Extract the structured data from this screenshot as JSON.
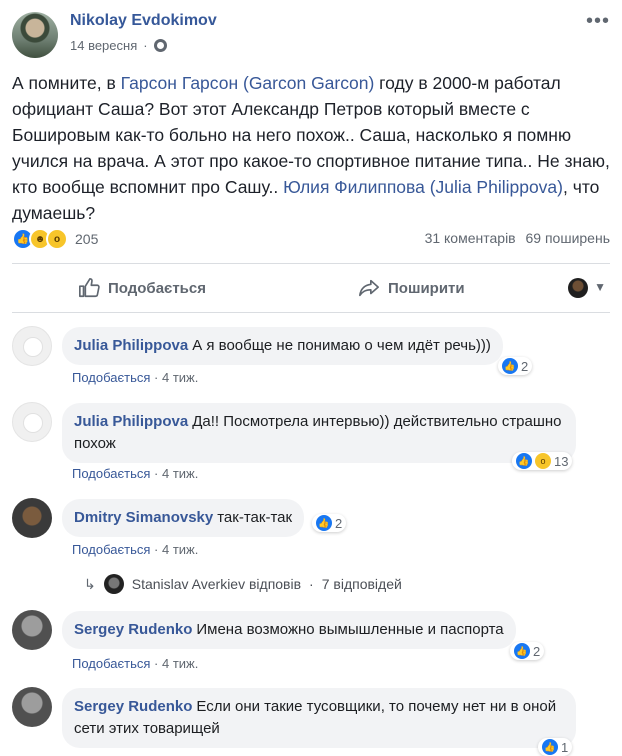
{
  "post": {
    "author": "Nikolay Evdokimov",
    "date": "14 вересня",
    "text_parts": [
      "А помните, в ",
      "Гарсон Гарсон (Garcon Garcon)",
      " году в 2000-м работал официант Саша? Вот этот Александр Петров который вместе с Бошировым как-то больно на него похож.. Саша, насколько я помню учился на врача. А этот про какое-то спортивное питание типа.. Не знаю, кто вообще вспомнит про Сашу.. ",
      "Юлия Филиппова (Julia Philippova)",
      ", что думаешь?"
    ],
    "reactions_count": "205",
    "comments_count": "31 коментарів",
    "shares_count": "69 поширень"
  },
  "actions": {
    "like": "Подобається",
    "share": "Поширити"
  },
  "comments": [
    {
      "name": "Julia Philippova",
      "text": "А я вообще не понимаю о чем идёт речь)))",
      "like": "Подобається",
      "time": "4 тиж.",
      "reactions": "2"
    },
    {
      "name": "Julia Philippova",
      "text": "Да!! Посмотрела интервью)) действительно страшно похож",
      "like": "Подобається",
      "time": "4 тиж.",
      "reactions": "13"
    },
    {
      "name": "Dmitry Simanovsky",
      "text": "так-так-так",
      "like": "Подобається",
      "time": "4 тиж.",
      "reactions": "2"
    },
    {
      "name": "Sergey Rudenko",
      "text": "Имена возможно вымышленные и паспорта",
      "like": "Подобається",
      "time": "4 тиж.",
      "reactions": "2"
    },
    {
      "name": "Sergey Rudenko",
      "text": "Если они такие тусовщики, то почему нет ни в оной сети этих товарищей",
      "reactions": "1"
    }
  ],
  "replies": {
    "author_reply": "Stanislav Averkiev відповів",
    "sep": "·",
    "count": "7 відповідей"
  },
  "separators": {
    "dot": "·"
  },
  "icons": {
    "globe": "globe-icon",
    "more": "more-icon",
    "like": "like-icon",
    "share": "share-icon"
  },
  "colors": {
    "link": "#385898",
    "like_blue": "#1877f2"
  }
}
